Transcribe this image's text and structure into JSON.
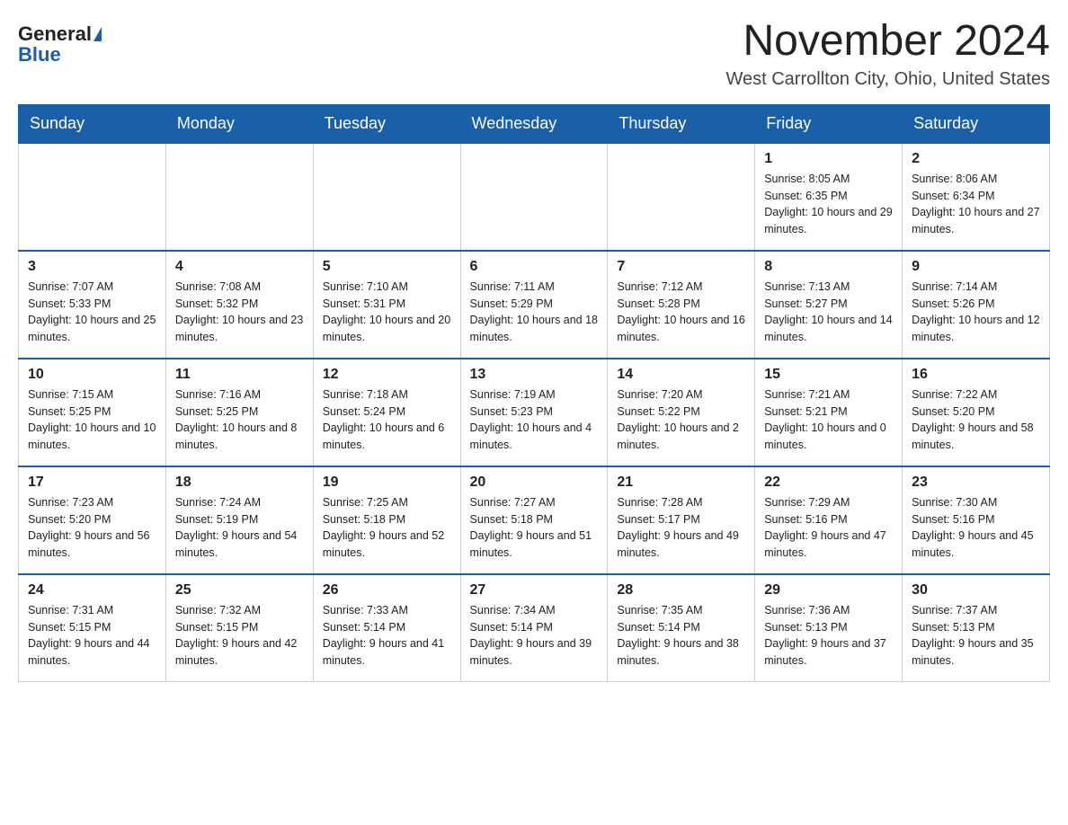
{
  "logo": {
    "general": "General",
    "blue": "Blue"
  },
  "header": {
    "title": "November 2024",
    "subtitle": "West Carrollton City, Ohio, United States"
  },
  "weekdays": [
    "Sunday",
    "Monday",
    "Tuesday",
    "Wednesday",
    "Thursday",
    "Friday",
    "Saturday"
  ],
  "weeks": [
    [
      {
        "day": "",
        "info": ""
      },
      {
        "day": "",
        "info": ""
      },
      {
        "day": "",
        "info": ""
      },
      {
        "day": "",
        "info": ""
      },
      {
        "day": "",
        "info": ""
      },
      {
        "day": "1",
        "info": "Sunrise: 8:05 AM\nSunset: 6:35 PM\nDaylight: 10 hours and 29 minutes."
      },
      {
        "day": "2",
        "info": "Sunrise: 8:06 AM\nSunset: 6:34 PM\nDaylight: 10 hours and 27 minutes."
      }
    ],
    [
      {
        "day": "3",
        "info": "Sunrise: 7:07 AM\nSunset: 5:33 PM\nDaylight: 10 hours and 25 minutes."
      },
      {
        "day": "4",
        "info": "Sunrise: 7:08 AM\nSunset: 5:32 PM\nDaylight: 10 hours and 23 minutes."
      },
      {
        "day": "5",
        "info": "Sunrise: 7:10 AM\nSunset: 5:31 PM\nDaylight: 10 hours and 20 minutes."
      },
      {
        "day": "6",
        "info": "Sunrise: 7:11 AM\nSunset: 5:29 PM\nDaylight: 10 hours and 18 minutes."
      },
      {
        "day": "7",
        "info": "Sunrise: 7:12 AM\nSunset: 5:28 PM\nDaylight: 10 hours and 16 minutes."
      },
      {
        "day": "8",
        "info": "Sunrise: 7:13 AM\nSunset: 5:27 PM\nDaylight: 10 hours and 14 minutes."
      },
      {
        "day": "9",
        "info": "Sunrise: 7:14 AM\nSunset: 5:26 PM\nDaylight: 10 hours and 12 minutes."
      }
    ],
    [
      {
        "day": "10",
        "info": "Sunrise: 7:15 AM\nSunset: 5:25 PM\nDaylight: 10 hours and 10 minutes."
      },
      {
        "day": "11",
        "info": "Sunrise: 7:16 AM\nSunset: 5:25 PM\nDaylight: 10 hours and 8 minutes."
      },
      {
        "day": "12",
        "info": "Sunrise: 7:18 AM\nSunset: 5:24 PM\nDaylight: 10 hours and 6 minutes."
      },
      {
        "day": "13",
        "info": "Sunrise: 7:19 AM\nSunset: 5:23 PM\nDaylight: 10 hours and 4 minutes."
      },
      {
        "day": "14",
        "info": "Sunrise: 7:20 AM\nSunset: 5:22 PM\nDaylight: 10 hours and 2 minutes."
      },
      {
        "day": "15",
        "info": "Sunrise: 7:21 AM\nSunset: 5:21 PM\nDaylight: 10 hours and 0 minutes."
      },
      {
        "day": "16",
        "info": "Sunrise: 7:22 AM\nSunset: 5:20 PM\nDaylight: 9 hours and 58 minutes."
      }
    ],
    [
      {
        "day": "17",
        "info": "Sunrise: 7:23 AM\nSunset: 5:20 PM\nDaylight: 9 hours and 56 minutes."
      },
      {
        "day": "18",
        "info": "Sunrise: 7:24 AM\nSunset: 5:19 PM\nDaylight: 9 hours and 54 minutes."
      },
      {
        "day": "19",
        "info": "Sunrise: 7:25 AM\nSunset: 5:18 PM\nDaylight: 9 hours and 52 minutes."
      },
      {
        "day": "20",
        "info": "Sunrise: 7:27 AM\nSunset: 5:18 PM\nDaylight: 9 hours and 51 minutes."
      },
      {
        "day": "21",
        "info": "Sunrise: 7:28 AM\nSunset: 5:17 PM\nDaylight: 9 hours and 49 minutes."
      },
      {
        "day": "22",
        "info": "Sunrise: 7:29 AM\nSunset: 5:16 PM\nDaylight: 9 hours and 47 minutes."
      },
      {
        "day": "23",
        "info": "Sunrise: 7:30 AM\nSunset: 5:16 PM\nDaylight: 9 hours and 45 minutes."
      }
    ],
    [
      {
        "day": "24",
        "info": "Sunrise: 7:31 AM\nSunset: 5:15 PM\nDaylight: 9 hours and 44 minutes."
      },
      {
        "day": "25",
        "info": "Sunrise: 7:32 AM\nSunset: 5:15 PM\nDaylight: 9 hours and 42 minutes."
      },
      {
        "day": "26",
        "info": "Sunrise: 7:33 AM\nSunset: 5:14 PM\nDaylight: 9 hours and 41 minutes."
      },
      {
        "day": "27",
        "info": "Sunrise: 7:34 AM\nSunset: 5:14 PM\nDaylight: 9 hours and 39 minutes."
      },
      {
        "day": "28",
        "info": "Sunrise: 7:35 AM\nSunset: 5:14 PM\nDaylight: 9 hours and 38 minutes."
      },
      {
        "day": "29",
        "info": "Sunrise: 7:36 AM\nSunset: 5:13 PM\nDaylight: 9 hours and 37 minutes."
      },
      {
        "day": "30",
        "info": "Sunrise: 7:37 AM\nSunset: 5:13 PM\nDaylight: 9 hours and 35 minutes."
      }
    ]
  ]
}
